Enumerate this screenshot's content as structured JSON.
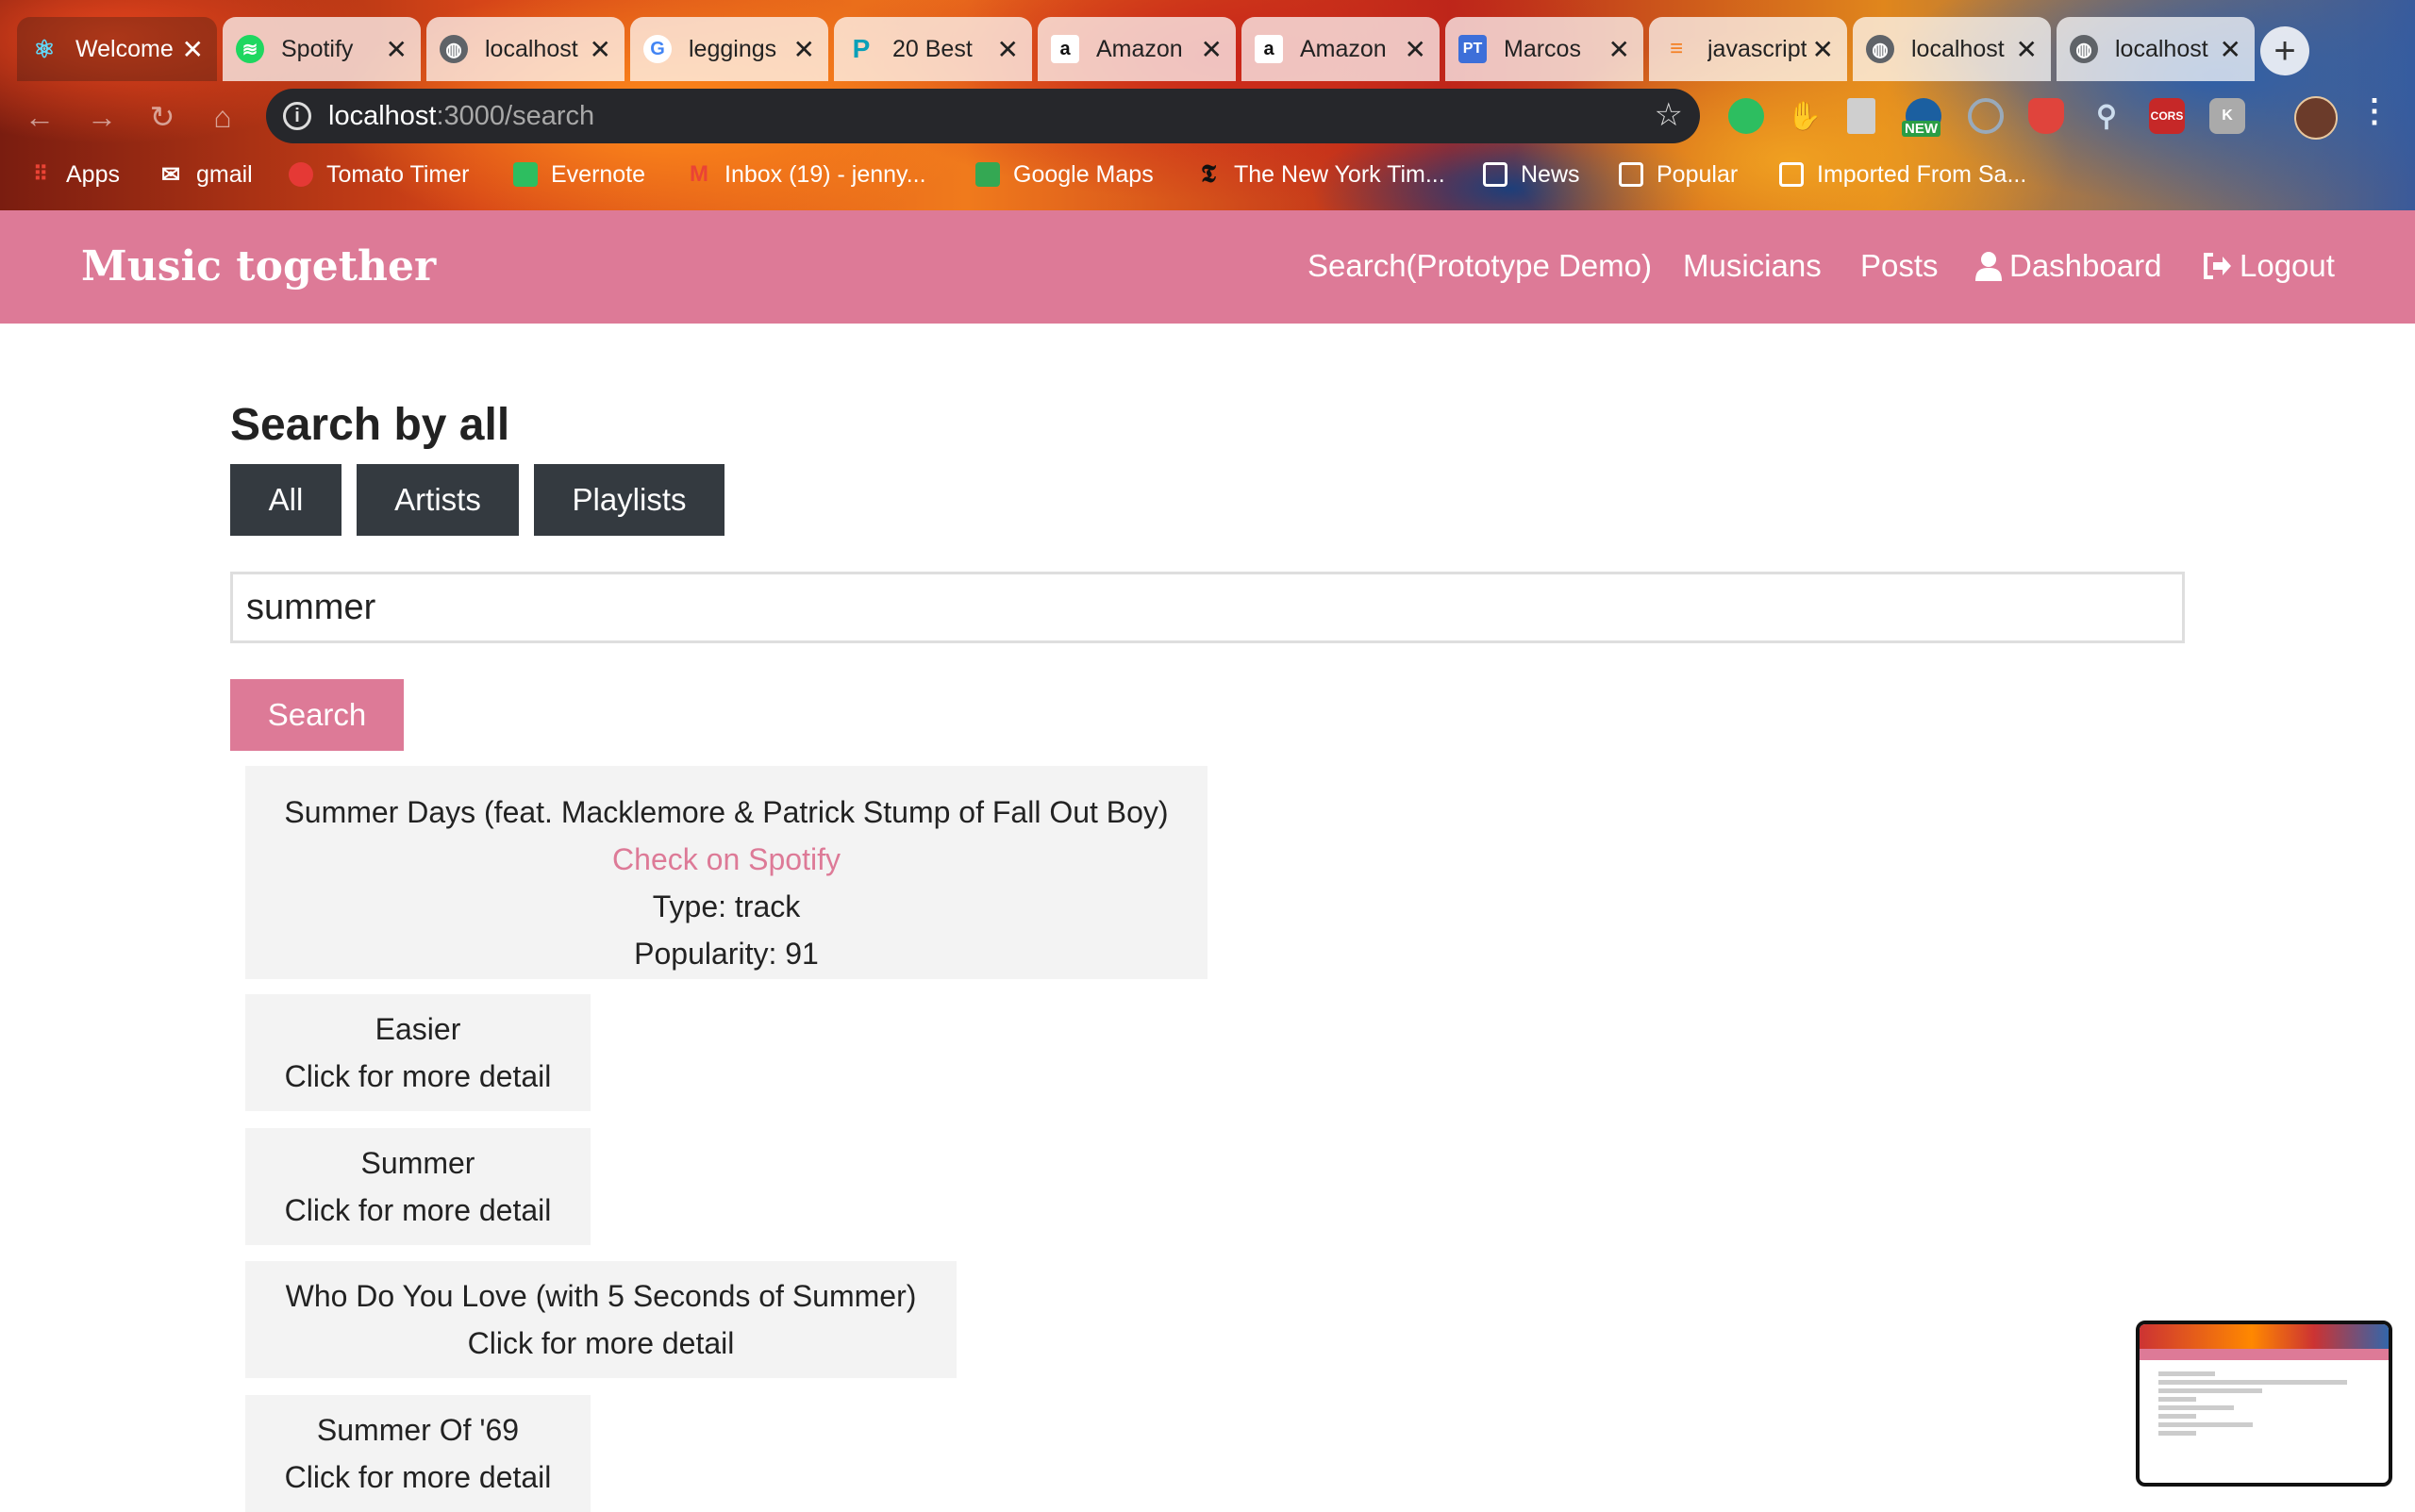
{
  "browser": {
    "tabs": [
      {
        "title": "Welcome",
        "favicon": "react-icon",
        "color": "#61dafb",
        "active": true
      },
      {
        "title": "Spotify",
        "favicon": "spotify-icon",
        "color": "#1ed760"
      },
      {
        "title": "localhost",
        "favicon": "globe-icon",
        "color": "#5f6368"
      },
      {
        "title": "leggings",
        "favicon": "google-icon",
        "color": "#4285f4"
      },
      {
        "title": "20 Best",
        "favicon": "p-icon",
        "color": "#0aa0b8"
      },
      {
        "title": "Amazon",
        "favicon": "amazon-icon",
        "color": "#111111"
      },
      {
        "title": "Amazon",
        "favicon": "amazon-icon",
        "color": "#111111"
      },
      {
        "title": "Marcos",
        "favicon": "pt-icon",
        "color": "#3d6fd9"
      },
      {
        "title": "javascript",
        "favicon": "stack-icon",
        "color": "#f48024"
      },
      {
        "title": "localhost",
        "favicon": "globe-icon",
        "color": "#5f6368"
      },
      {
        "title": "localhost",
        "favicon": "globe-icon",
        "color": "#5f6368"
      }
    ],
    "url_host": "localhost",
    "url_path": ":3000/search",
    "extensions": [
      {
        "name": "evernote-ext-icon",
        "color": "#2dbe60",
        "label": ""
      },
      {
        "name": "hand-ext-icon",
        "color": "#e03030",
        "label": ""
      },
      {
        "name": "doc-ext-icon",
        "color": "#cfcfcf",
        "label": ""
      },
      {
        "name": "new-ext-icon",
        "color": "#2a9d45",
        "label": "NEW"
      },
      {
        "name": "eye-ext-icon",
        "color": "#9ab",
        "label": ""
      },
      {
        "name": "shield-ext-icon",
        "color": "#e0443c",
        "label": ""
      },
      {
        "name": "search-ext-icon",
        "color": "#8aa",
        "label": ""
      },
      {
        "name": "cors-ext-icon",
        "color": "#c62828",
        "label": "CORS"
      },
      {
        "name": "k-ext-icon",
        "color": "#aaaaaa",
        "label": "K"
      }
    ],
    "bookmarks": [
      {
        "label": "Apps",
        "icon": "apps-icon",
        "color": "#ea4335"
      },
      {
        "label": "gmail",
        "icon": "mail-icon",
        "color": "#ffffff"
      },
      {
        "label": "Tomato Timer",
        "icon": "tomato-icon",
        "color": "#e53935"
      },
      {
        "label": "Evernote",
        "icon": "evernote-icon",
        "color": "#2dbe60"
      },
      {
        "label": "Inbox (19) - jenny...",
        "icon": "gmail-icon",
        "color": "#ea4335"
      },
      {
        "label": "Google Maps",
        "icon": "maps-icon",
        "color": "#34a853"
      },
      {
        "label": "The New York Tim...",
        "icon": "nyt-icon",
        "color": "#111111"
      },
      {
        "label": "News",
        "icon": "folder-icon",
        "color": "#ffffff"
      },
      {
        "label": "Popular",
        "icon": "folder-icon",
        "color": "#ffffff"
      },
      {
        "label": "Imported From Sa...",
        "icon": "folder-icon",
        "color": "#ffffff"
      }
    ]
  },
  "navbar": {
    "brand": "Music together",
    "links": [
      {
        "label": "Search(Prototype Demo)",
        "icon": ""
      },
      {
        "label": "Musicians",
        "icon": ""
      },
      {
        "label": "Posts",
        "icon": ""
      },
      {
        "label": "Dashboard",
        "icon": "user-icon"
      },
      {
        "label": "Logout",
        "icon": "logout-icon"
      }
    ],
    "color": "#dd7a97"
  },
  "main": {
    "heading": "Search by all",
    "filters": [
      "All",
      "Artists",
      "Playlists"
    ],
    "search_value": "summer",
    "search_button": "Search",
    "results": [
      {
        "lines": [
          "Summer Days (feat. Macklemore & Patrick Stump of Fall Out Boy)",
          "Check on Spotify",
          "Type: track",
          "Popularity: 91"
        ],
        "link_index": 1
      },
      {
        "lines": [
          "Easier",
          "Click for more detail"
        ]
      },
      {
        "lines": [
          "Summer",
          "Click for more detail"
        ]
      },
      {
        "lines": [
          "Who Do You Love (with 5 Seconds of Summer)",
          "Click for more detail"
        ]
      },
      {
        "lines": [
          "Summer Of '69",
          "Click for more detail"
        ]
      }
    ]
  }
}
